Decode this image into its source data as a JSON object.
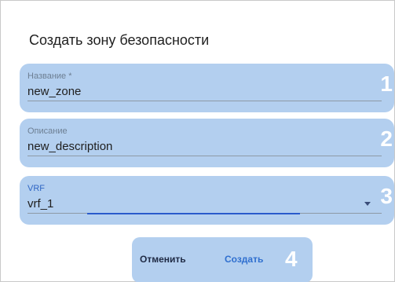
{
  "dialog": {
    "title": "Создать зону безопасности"
  },
  "fields": {
    "name": {
      "label": "Название *",
      "value": "new_zone",
      "marker": "1"
    },
    "description": {
      "label": "Описание",
      "value": "new_description",
      "marker": "2"
    },
    "vrf": {
      "label": "VRF",
      "value": "vrf_1",
      "marker": "3",
      "icon": "chevron-down-icon"
    }
  },
  "actions": {
    "cancel_label": "Отменить",
    "create_label": "Создать",
    "marker": "4"
  },
  "colors": {
    "highlight": "#b3cfef",
    "accent": "#2f6fcf",
    "marker": "#ffffff"
  }
}
